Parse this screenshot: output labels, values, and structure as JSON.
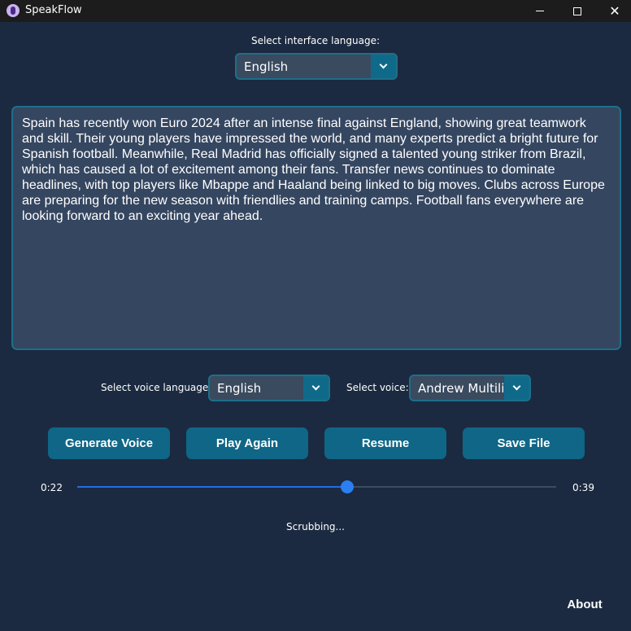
{
  "window": {
    "title": "SpeakFlow",
    "icon": "app-logo-icon"
  },
  "interface_language": {
    "label": "Select interface language:",
    "value": "English"
  },
  "text_input": {
    "value": "Spain has recently won Euro 2024 after an intense final against England, showing great teamwork and skill. Their young players have impressed the world, and many experts predict a bright future for Spanish football. Meanwhile, Real Madrid has officially signed a talented young striker from Brazil, which has caused a lot of excitement among their fans. Transfer news continues to dominate headlines, with top players like Mbappe and Haaland being linked to big moves. Clubs across Europe are preparing for the new season with friendlies and training camps. Football fans everywhere are looking forward to an exciting year ahead."
  },
  "voice_language": {
    "label": "Select voice language:",
    "value": "English"
  },
  "voice": {
    "label": "Select voice:",
    "value": "Andrew Multilingual"
  },
  "buttons": {
    "generate": "Generate Voice",
    "play_again": "Play Again",
    "resume": "Resume",
    "save": "Save File"
  },
  "playback": {
    "current_time": "0:22",
    "total_time": "0:39",
    "progress": 0.564
  },
  "status": "Scrubbing...",
  "about": "About",
  "colors": {
    "background": "#1b2a40",
    "accent": "#0f6686",
    "slider": "#1f6fe5"
  }
}
